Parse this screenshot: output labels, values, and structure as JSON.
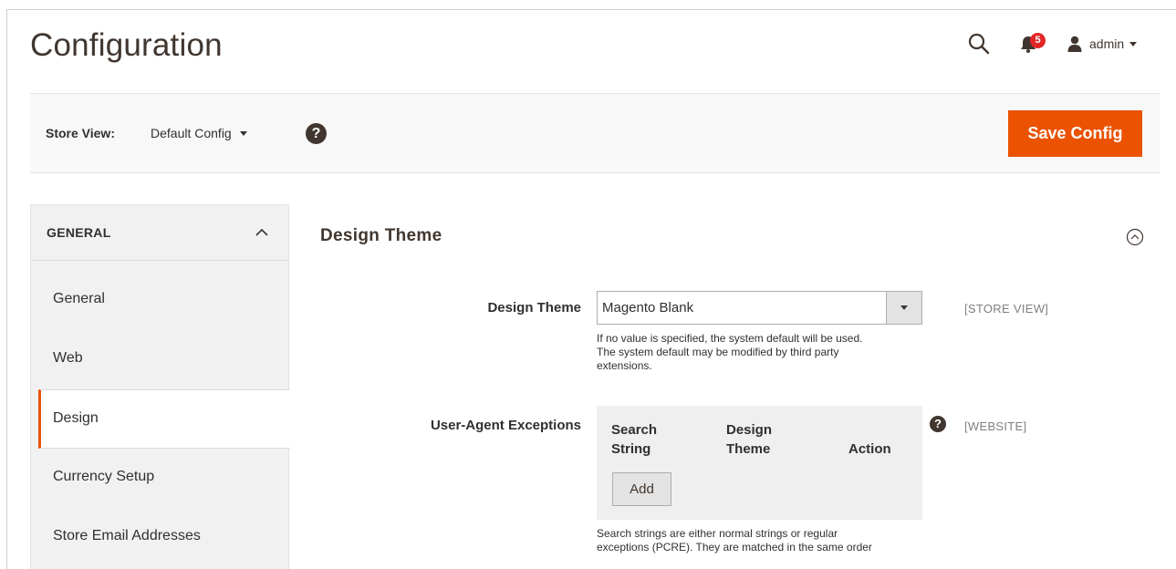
{
  "page": {
    "title": "Configuration"
  },
  "header": {
    "notifications_count": "5",
    "user_name": "admin"
  },
  "store_bar": {
    "label": "Store View:",
    "scope_value": "Default Config",
    "save_label": "Save Config"
  },
  "sidebar": {
    "group_label": "GENERAL",
    "items": [
      {
        "label": "General"
      },
      {
        "label": "Web"
      },
      {
        "label": "Design"
      },
      {
        "label": "Currency Setup"
      },
      {
        "label": "Store Email Addresses"
      }
    ]
  },
  "section": {
    "title": "Design Theme",
    "design_theme": {
      "label": "Design Theme",
      "value": "Magento Blank",
      "scope": "[STORE VIEW]",
      "note_lines": [
        "If no value is specified, the system default will be used.",
        "The system default may be modified by third party",
        "extensions."
      ]
    },
    "exceptions": {
      "label": "User-Agent Exceptions",
      "scope": "[WEBSITE]",
      "columns": [
        "Search String",
        "Design Theme",
        "Action"
      ],
      "add_label": "Add",
      "note_lines": [
        "Search strings are either normal strings or regular",
        "exceptions (PCRE). They are matched in the same order"
      ]
    }
  },
  "colors": {
    "accent": "#eb5202",
    "badge": "#e22626",
    "title": "#41362f"
  },
  "icons": [
    "search-icon",
    "bell-icon",
    "user-icon",
    "help-icon",
    "chevron-up-icon",
    "collapse-circle-icon",
    "tooltip-icon"
  ]
}
